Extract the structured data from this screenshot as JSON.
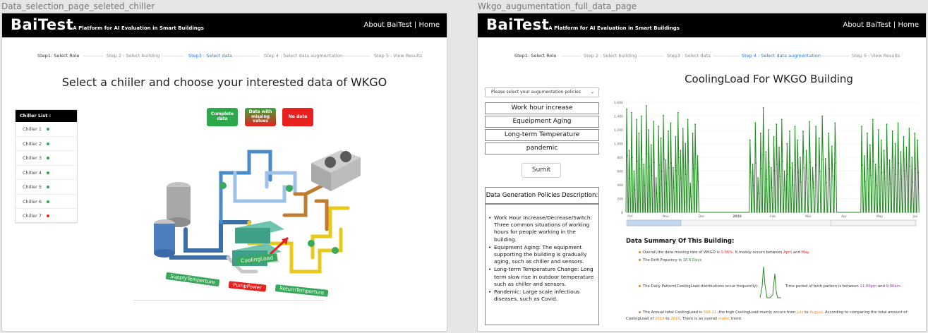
{
  "left_panel": {
    "caption": "Data_selection_page_seleted_chiller",
    "header": {
      "logo": "BaiTest",
      "tagline": "-- A Platform for AI Evaluation in Smart Buildings",
      "nav": "About BaiTest | Home"
    },
    "steps": [
      "Step1: Select Role",
      "Step 2 : Select building",
      "Step3 : Select data",
      "Step 4 : Select data augmentation",
      "Step 5 : View Results"
    ],
    "current_step": 2,
    "title": "Select a chiiler and choose your interested data of WKGO",
    "chiller_list": {
      "header": "Chiller List :",
      "items": [
        {
          "label": "Chiller 1",
          "status": "green"
        },
        {
          "label": "Chiller 2",
          "status": "green"
        },
        {
          "label": "Chiller 3",
          "status": "green"
        },
        {
          "label": "Chiller 4",
          "status": "green"
        },
        {
          "label": "Chiller 5",
          "status": "green"
        },
        {
          "label": "Chiller 6",
          "status": "green"
        },
        {
          "label": "Chiller 7",
          "status": "red"
        }
      ]
    },
    "legend": {
      "complete": "Complete data",
      "missing": "Data with missing values",
      "nodata": "No data"
    },
    "plant_labels": {
      "cooling": "CoolingLoad",
      "supply": "SupplyTemperture",
      "pump": "PumpPower",
      "return": "ReturnTemperture"
    },
    "colors": {
      "green": "#2aa84a",
      "red": "#e8201e",
      "accent": "#2a6fd6"
    }
  },
  "right_panel": {
    "caption": "Wkgo_augumentation_full_data_page",
    "header": {
      "logo": "BaiTest",
      "tagline": "-- A Platform for AI Evaluation in Smart Buildings",
      "nav": "About BaiTest | Home"
    },
    "steps": [
      "Step1: Select Role",
      "Step 2 : Select building",
      "Step3 : Select data",
      "Step 4 : Select data augmentation",
      "Step 5 : View Results"
    ],
    "current_step": 3,
    "title": "CoolingLoad For WKGO Building",
    "policy_select_placeholder": "Please select your augumentation policies",
    "policies": [
      "Work hour increase",
      "Equeipment Aging",
      "Long-term Temperature",
      "pandemic"
    ],
    "submit_label": "Sumit",
    "desc_title": "Data Generation Policies Description:",
    "descriptions": [
      "Work Hour Increase/Decrease/Switch: Three common situations of working hours for people working in the building.",
      "Equipment Aging: The equipment supporting the building is gradually aging, such as chiller and sensors.",
      "Long-term Temperature Change: Long term slow rise in outdoor temperature such as chiller and sensors.",
      "Pandemic: Large scale infectious diseases, such as Covid."
    ],
    "summary_title": "Data Summary Of This Building:",
    "summary": {
      "l1_a": "Overall,the data missing rate of WKGO is ",
      "l1_v": "0.06%",
      "l1_b": ". It mainly occurs between ",
      "l1_m1": "April",
      "l1_c": " and ",
      "l1_m2": "May",
      "l1_d": ".",
      "l2_a": "The Drift Frquency is ",
      "l2_v": "18.6 Days",
      "l3_a": "The Daily Pattern(CoolingLoad distributions occur frequently):",
      "l3_b": "Time period of both pattern is between ",
      "l3_t1": "11:00pm",
      "l3_c": " and ",
      "l3_t2": "9:00am",
      "l3_d": ".",
      "l4_a": "The Annual total CoolingLoad is ",
      "l4_v": "398.11",
      "l4_b": " ,the high CoolingLoad mainly occurs from ",
      "l4_m1": "July",
      "l4_c": " to ",
      "l4_m2": "August",
      "l4_d": ". According to comparing the total amount of",
      "l5_a": "CoolingLoad of ",
      "l5_y1": "2019",
      "l5_b": " to ",
      "l5_y2": "2020",
      "l5_c": ", There is an overall ",
      "l5_v": "stable",
      "l5_d": " trend."
    }
  },
  "chart_data": {
    "type": "line",
    "title": "CoolingLoad For WKGO Building",
    "x_tick_labels": [
      "Oct",
      "Nov",
      "Dec",
      "2020",
      "Feb",
      "Mar",
      "Apr",
      "May",
      "Jun"
    ],
    "y_tick_labels": [
      "0",
      "200",
      "400",
      "600",
      "800",
      "1,000",
      "1,200",
      "1,400",
      "1,600"
    ],
    "ylim": [
      0,
      1600
    ],
    "series": [
      {
        "color": "#1d8a1d",
        "segments": [
          {
            "x_start": 0.0,
            "x_end": 0.25,
            "peaks": [
              1500,
              900,
              1450,
              600,
              1350,
              1150,
              1400,
              700,
              1550,
              1200,
              980,
              1320,
              500,
              1250,
              1080,
              1410,
              760,
              1180,
              1300,
              650,
              1100,
              1450,
              900,
              1220,
              1000,
              1350,
              420,
              1150,
              1280,
              820
            ]
          },
          {
            "x_start": 0.25,
            "x_end": 0.42,
            "peaks": [
              0
            ]
          },
          {
            "x_start": 0.42,
            "x_end": 0.6,
            "peaks": [
              1050,
              700,
              1300,
              500,
              1150,
              1520,
              880,
              1200,
              650,
              1100,
              1280,
              950,
              1350,
              600,
              1000,
              1180,
              720,
              1250,
              1050,
              800
            ]
          },
          {
            "x_start": 0.6,
            "x_end": 0.72,
            "peaks": [
              1180,
              900,
              1320,
              650,
              1250,
              1080,
              1400,
              780,
              1150,
              960,
              1300
            ]
          },
          {
            "x_start": 0.72,
            "x_end": 0.8,
            "peaks": [
              0
            ]
          },
          {
            "x_start": 0.8,
            "x_end": 1.0,
            "peaks": [
              1250,
              820,
              1150,
              980,
              1350,
              700,
              1200,
              1050,
              900,
              1280,
              760,
              1180,
              1000,
              1300,
              880,
              1100,
              950,
              1220,
              800,
              1150,
              1050
            ]
          }
        ]
      }
    ]
  }
}
